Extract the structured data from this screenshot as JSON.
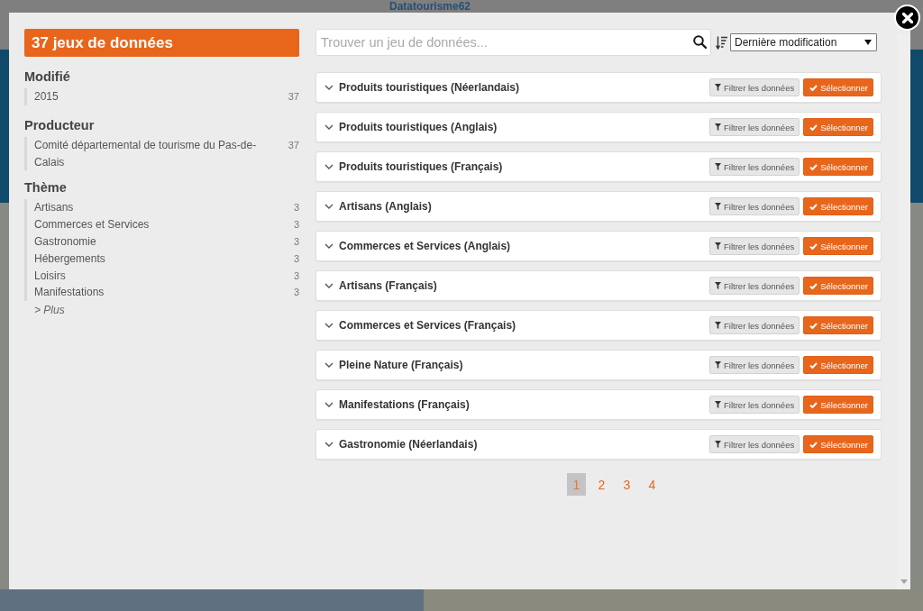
{
  "background": {
    "logo": "Datatourisme62"
  },
  "sidebar": {
    "count_title": "37 jeux de données",
    "facets": [
      {
        "title": "Modifié",
        "items": [
          {
            "label": "2015",
            "count": "37"
          }
        ]
      },
      {
        "title": "Producteur",
        "items": [
          {
            "label": "Comité départemental de tourisme du Pas-de-Calais",
            "count": "37"
          }
        ]
      },
      {
        "title": "Thème",
        "items": [
          {
            "label": "Artisans",
            "count": "3"
          },
          {
            "label": "Commerces et Services",
            "count": "3"
          },
          {
            "label": "Gastronomie",
            "count": "3"
          },
          {
            "label": "Hébergements",
            "count": "3"
          },
          {
            "label": "Loisirs",
            "count": "3"
          },
          {
            "label": "Manifestations",
            "count": "3"
          }
        ],
        "more": "> Plus"
      }
    ]
  },
  "search": {
    "placeholder": "Trouver un jeu de données..."
  },
  "sort": {
    "value": "Dernière modification"
  },
  "datasets": [
    {
      "title": "Produits touristiques (Néerlandais)",
      "filter_button": "Filtrer les données",
      "select_button": "Sélectionner"
    },
    {
      "title": "Produits touristiques (Anglais)",
      "filter_button": "Filtrer les données",
      "select_button": "Sélectionner"
    },
    {
      "title": "Produits touristiques (Français)",
      "filter_button": "Filtrer les données",
      "select_button": "Sélectionner"
    },
    {
      "title": "Artisans (Anglais)",
      "filter_button": "Filtrer les données",
      "select_button": "Sélectionner"
    },
    {
      "title": "Commerces et Services (Anglais)",
      "filter_button": "Filtrer les données",
      "select_button": "Sélectionner"
    },
    {
      "title": "Artisans (Français)",
      "filter_button": "Filtrer les données",
      "select_button": "Sélectionner"
    },
    {
      "title": "Commerces et Services (Français)",
      "filter_button": "Filtrer les données",
      "select_button": "Sélectionner"
    },
    {
      "title": "Pleine Nature (Français)",
      "filter_button": "Filtrer les données",
      "select_button": "Sélectionner"
    },
    {
      "title": "Manifestations (Français)",
      "filter_button": "Filtrer les données",
      "select_button": "Sélectionner"
    },
    {
      "title": "Gastronomie (Néerlandais)",
      "filter_button": "Filtrer les données",
      "select_button": "Sélectionner"
    }
  ],
  "pagination": [
    {
      "label": "1",
      "selected": true
    },
    {
      "label": "2",
      "selected": false
    },
    {
      "label": "3",
      "selected": false
    },
    {
      "label": "4",
      "selected": false
    }
  ]
}
